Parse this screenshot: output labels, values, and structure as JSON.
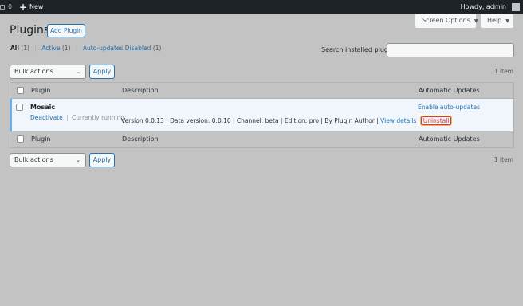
{
  "adminbar": {
    "comment_count": "0",
    "new_label": "New",
    "howdy": "Howdy, admin"
  },
  "tabs": {
    "screen_options": "Screen Options",
    "help": "Help"
  },
  "page": {
    "title": "Plugins",
    "add_plugin": "Add Plugin"
  },
  "views": [
    {
      "label": "All",
      "count": "(1)"
    },
    {
      "label": "Active",
      "count": "(1)"
    },
    {
      "label": "Auto-updates Disabled",
      "count": "(1)"
    }
  ],
  "search": {
    "label": "Search installed plugins",
    "value": ""
  },
  "bulk": {
    "select_value": "Bulk actions",
    "apply": "Apply",
    "count": "1 item"
  },
  "columns": {
    "plugin": "Plugin",
    "description": "Description",
    "auto_updates": "Automatic Updates"
  },
  "plugin_row": {
    "name": "Mosaic",
    "deactivate": "Deactivate",
    "separator": "|",
    "status": "Currently running",
    "description": "Version 0.0.13 | Data version: 0.0.10 | Channel: beta | Edition: pro | By Plugin Author |",
    "view_details": "View details",
    "uninstall": "Uninstall",
    "auto_update_link": "Enable auto-updates"
  },
  "colors": {
    "adminbar": "#1d2327",
    "link": "#2271b1",
    "active_row_bg": "#f0f6fc",
    "active_row_border": "#72aee6",
    "uninstall_outline": "#d63638"
  }
}
